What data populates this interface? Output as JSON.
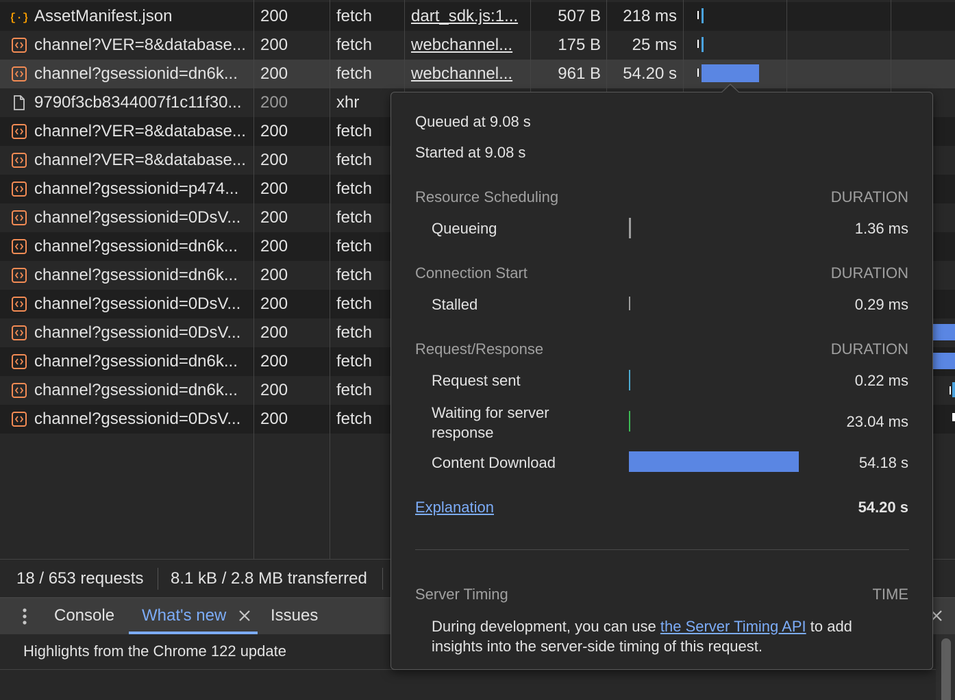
{
  "requests": [
    {
      "icon": "json-file-icon",
      "name": "AssetManifest.json",
      "status": "200",
      "status_dim": false,
      "type": "fetch",
      "initiator": "dart_sdk.js:1...",
      "size": "507 B",
      "time": "218 ms"
    },
    {
      "icon": "fetch-request-icon",
      "name": "channel?VER=8&database...",
      "status": "200",
      "status_dim": false,
      "type": "fetch",
      "initiator": "webchannel...",
      "size": "175 B",
      "time": "25 ms"
    },
    {
      "icon": "fetch-request-icon",
      "name": "channel?gsessionid=dn6k...",
      "status": "200",
      "status_dim": false,
      "type": "fetch",
      "initiator": "webchannel...",
      "size": "961 B",
      "time": "54.20 s"
    },
    {
      "icon": "document-icon",
      "name": "9790f3cb8344007f1c11f30...",
      "status": "200",
      "status_dim": true,
      "type": "xhr",
      "initiator": "",
      "size": "",
      "time": ""
    },
    {
      "icon": "fetch-request-icon",
      "name": "channel?VER=8&database...",
      "status": "200",
      "status_dim": false,
      "type": "fetch",
      "initiator": "",
      "size": "",
      "time": ""
    },
    {
      "icon": "fetch-request-icon",
      "name": "channel?VER=8&database...",
      "status": "200",
      "status_dim": false,
      "type": "fetch",
      "initiator": "",
      "size": "",
      "time": ""
    },
    {
      "icon": "fetch-request-icon",
      "name": "channel?gsessionid=p474...",
      "status": "200",
      "status_dim": false,
      "type": "fetch",
      "initiator": "",
      "size": "",
      "time": ""
    },
    {
      "icon": "fetch-request-icon",
      "name": "channel?gsessionid=0DsV...",
      "status": "200",
      "status_dim": false,
      "type": "fetch",
      "initiator": "",
      "size": "",
      "time": ""
    },
    {
      "icon": "fetch-request-icon",
      "name": "channel?gsessionid=dn6k...",
      "status": "200",
      "status_dim": false,
      "type": "fetch",
      "initiator": "",
      "size": "",
      "time": ""
    },
    {
      "icon": "fetch-request-icon",
      "name": "channel?gsessionid=dn6k...",
      "status": "200",
      "status_dim": false,
      "type": "fetch",
      "initiator": "",
      "size": "",
      "time": ""
    },
    {
      "icon": "fetch-request-icon",
      "name": "channel?gsessionid=0DsV...",
      "status": "200",
      "status_dim": false,
      "type": "fetch",
      "initiator": "",
      "size": "",
      "time": ""
    },
    {
      "icon": "fetch-request-icon",
      "name": "channel?gsessionid=0DsV...",
      "status": "200",
      "status_dim": false,
      "type": "fetch",
      "initiator": "",
      "size": "",
      "time": ""
    },
    {
      "icon": "fetch-request-icon",
      "name": "channel?gsessionid=dn6k...",
      "status": "200",
      "status_dim": false,
      "type": "fetch",
      "initiator": "",
      "size": "",
      "time": ""
    },
    {
      "icon": "fetch-request-icon",
      "name": "channel?gsessionid=dn6k...",
      "status": "200",
      "status_dim": false,
      "type": "fetch",
      "initiator": "",
      "size": "",
      "time": ""
    },
    {
      "icon": "fetch-request-icon",
      "name": "channel?gsessionid=0DsV...",
      "status": "200",
      "status_dim": false,
      "type": "fetch",
      "initiator": "",
      "size": "",
      "time": ""
    }
  ],
  "selected_row": 2,
  "summary": {
    "requests": "18 / 653 requests",
    "transferred": "8.1 kB / 2.8 MB transferred"
  },
  "drawer": {
    "menu_icon": "more-vertical-icon",
    "tabs": [
      {
        "label": "Console",
        "active": false
      },
      {
        "label": "What's new",
        "active": true,
        "closable": true
      },
      {
        "label": "Issues",
        "active": false
      }
    ],
    "body_text": "Highlights from the Chrome 122 update"
  },
  "timing": {
    "queued_at": "Queued at 9.08 s",
    "started_at": "Started at 9.08 s",
    "sections": [
      {
        "title": "Resource Scheduling",
        "column": "DURATION",
        "phases": [
          {
            "label": "Queueing",
            "value": "1.36 ms",
            "color": "#9e9e9e"
          }
        ]
      },
      {
        "title": "Connection Start",
        "column": "DURATION",
        "phases": [
          {
            "label": "Stalled",
            "value": "0.29 ms",
            "color": "#9e9e9e"
          }
        ]
      },
      {
        "title": "Request/Response",
        "column": "DURATION",
        "phases": [
          {
            "label": "Request sent",
            "value": "0.22 ms",
            "color": "#4dabd1"
          },
          {
            "label": "Waiting for server response",
            "value": "23.04 ms",
            "color": "#3cba54"
          },
          {
            "label": "Content Download",
            "value": "54.18 s",
            "color": "#5a86e3"
          }
        ]
      }
    ],
    "explanation_label": "Explanation",
    "total": "54.20 s",
    "server_timing": {
      "title": "Server Timing",
      "column": "TIME",
      "text_before": "During development, you can use ",
      "link": "the Server Timing API",
      "text_after": " to add insights into the server-side timing of this request."
    }
  },
  "colors": {
    "accent": "#7cacf8",
    "waterfall_bar": "#5a86e3",
    "waterfall_tick": "#4aa3df"
  }
}
